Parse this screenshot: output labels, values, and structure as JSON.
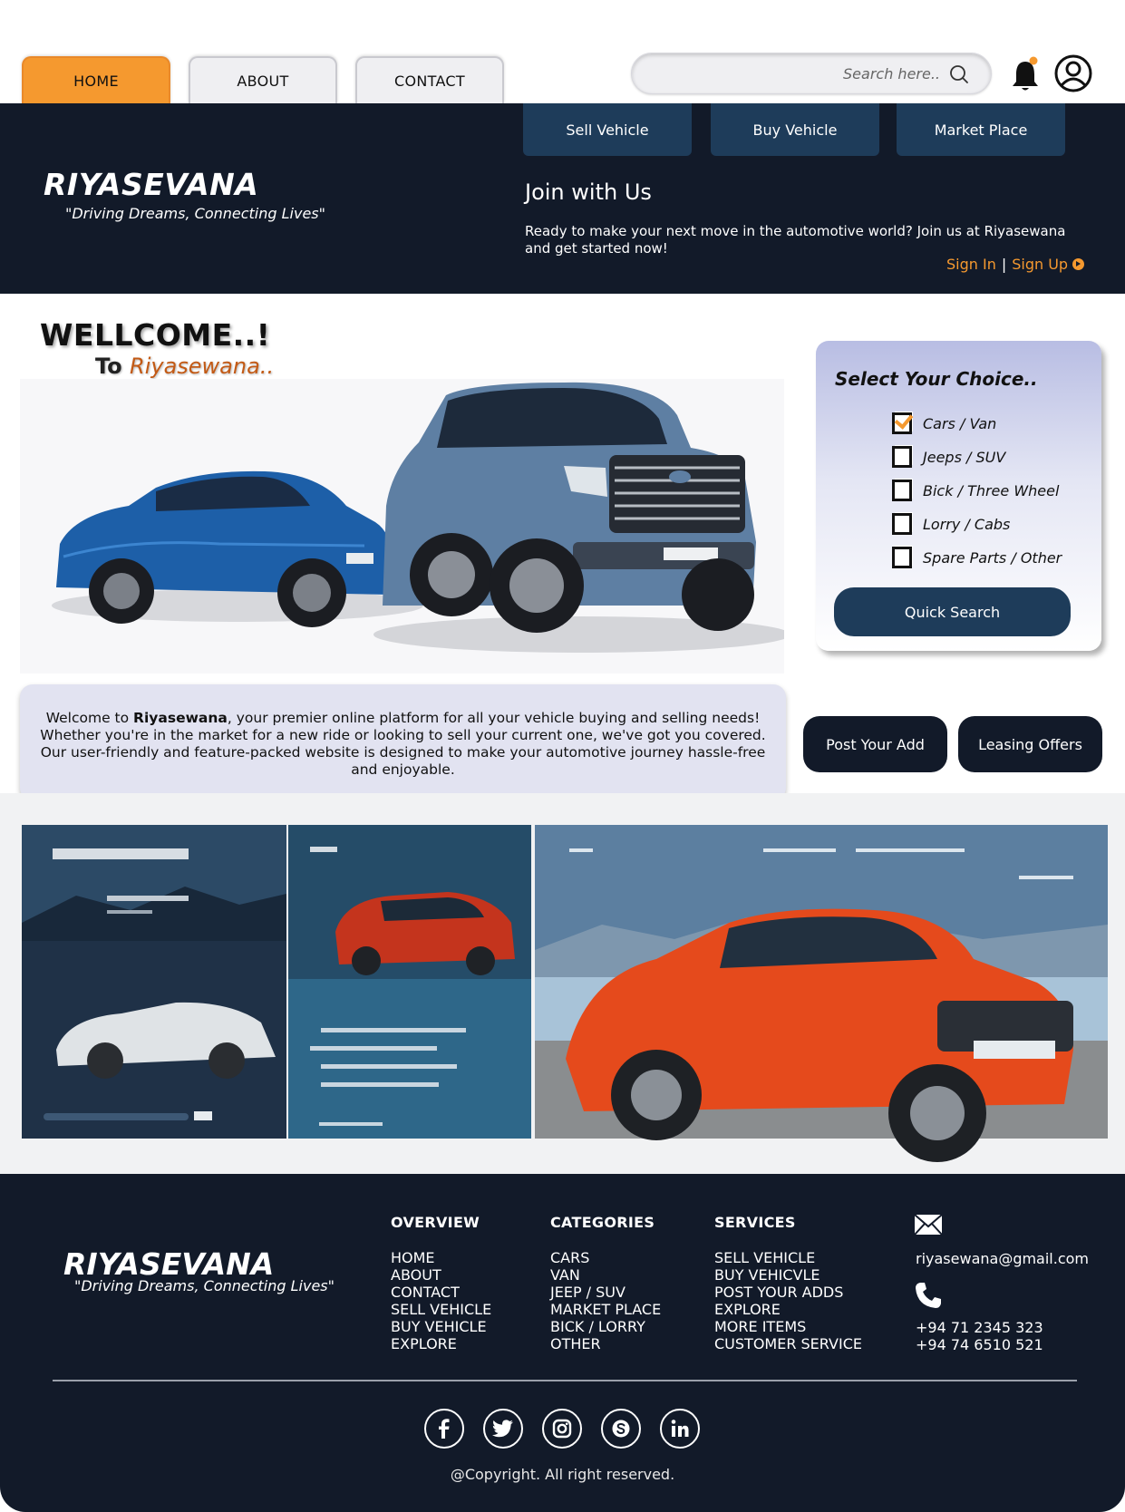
{
  "nav": {
    "tabs": [
      {
        "label": "HOME",
        "active": true
      },
      {
        "label": "ABOUT",
        "active": false
      },
      {
        "label": "CONTACT",
        "active": false
      }
    ],
    "search_placeholder": "Search here..",
    "icons": {
      "search": "search-icon",
      "notifications": "bell-icon",
      "profile": "user-icon"
    },
    "notification_dot_color": "#f5992f"
  },
  "header": {
    "buttons": [
      "Sell Vehicle",
      "Buy Vehicle",
      "Market Place"
    ],
    "brand": "RIYASEVANA",
    "tagline": "\"Driving Dreams, Connecting Lives\"",
    "join_title": "Join with Us",
    "join_text": "Ready to make your next move in the automotive world? Join us at Riyasewana and get started now!",
    "sign_in": "Sign In",
    "separator": "|",
    "sign_up": "Sign Up"
  },
  "welcome": {
    "heading": "WELLCOME..!",
    "to": "To",
    "brand": "Riyasewana.."
  },
  "choice": {
    "title": "Select Your Choice..",
    "options": [
      {
        "label": "Cars / Van",
        "checked": true
      },
      {
        "label": "Jeeps / SUV",
        "checked": false
      },
      {
        "label": "Bick / Three Wheel",
        "checked": false
      },
      {
        "label": "Lorry / Cabs",
        "checked": false
      },
      {
        "label": "Spare Parts / Other",
        "checked": false
      }
    ],
    "button": "Quick Search"
  },
  "intro": {
    "prefix": "Welcome to ",
    "brand": "Riyasewana",
    "text": ", your premier online platform for all your vehicle buying and selling needs! Whether you're in the market for a new ride or looking to sell your current one, we've got you covered. Our user-friendly and feature-packed website is designed to make your automotive journey hassle-free and enjoyable."
  },
  "actions": {
    "post": "Post Your Add",
    "leasing": "Leasing Offers"
  },
  "footer": {
    "brand": "RIYASEVANA",
    "tagline": "\"Driving Dreams, Connecting Lives\"",
    "columns": [
      {
        "title": "OVERVIEW",
        "items": [
          "HOME",
          "ABOUT",
          "CONTACT",
          "SELL VEHICLE",
          "BUY VEHICLE",
          "EXPLORE"
        ]
      },
      {
        "title": "CATEGORIES",
        "items": [
          "CARS",
          "VAN",
          "JEEP / SUV",
          "MARKET PLACE",
          "BICK / LORRY",
          "OTHER"
        ]
      },
      {
        "title": "SERVICES",
        "items": [
          "SELL VEHICLE",
          "BUY VEHICVLE",
          "POST YOUR ADDS",
          "EXPLORE",
          "MORE ITEMS",
          "CUSTOMER SERVICE"
        ]
      }
    ],
    "email": "riyasewana@gmail.com",
    "phones": [
      "+94 71 2345 323",
      "+94 74 6510 521"
    ],
    "social": [
      "facebook-icon",
      "twitter-icon",
      "instagram-icon",
      "skype-icon",
      "linkedin-icon"
    ],
    "copyright": "@Copyright. All right reserved."
  },
  "colors": {
    "accent": "#f5992f",
    "dark": "#121a29",
    "navy": "#1e3c5a",
    "lavender": "#e2e3f1"
  }
}
